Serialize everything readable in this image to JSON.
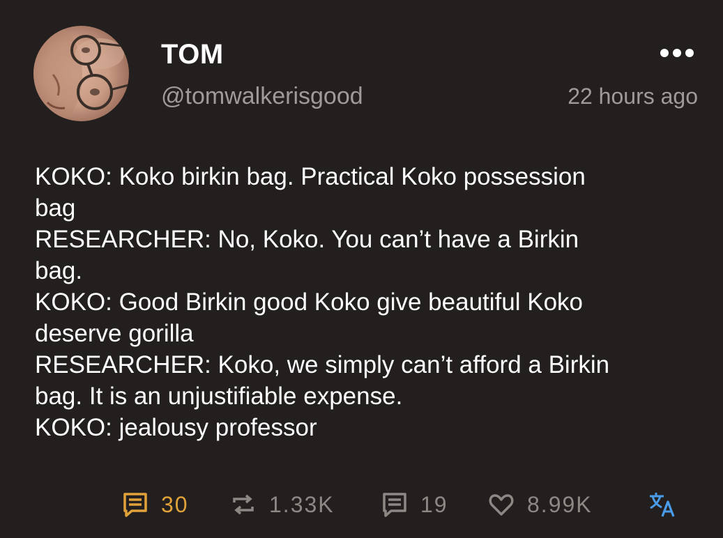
{
  "post": {
    "author": {
      "display_name": "TOM",
      "handle": "@tomwalkerisgood"
    },
    "timestamp": "22 hours ago",
    "content_lines": [
      "KOKO: Koko birkin bag. Practical Koko possession",
      "bag",
      "RESEARCHER: No, Koko. You can’t have a Birkin",
      "bag.",
      "KOKO: Good Birkin good Koko give beautiful Koko",
      "deserve gorilla",
      "RESEARCHER: Koko, we simply can’t afford a Birkin",
      "bag. It is an unjustifiable expense.",
      "KOKO: jealousy professor"
    ],
    "actions": {
      "replies": "30",
      "boosts": "1.33K",
      "quotes": "19",
      "likes": "8.99K"
    }
  },
  "icons": {
    "more": "more-horizontal-icon",
    "reply": "reply-icon",
    "boost": "repost-icon",
    "quote": "quote-icon",
    "like": "heart-icon",
    "translate": "translate-icon"
  },
  "colors": {
    "background": "#231f1e",
    "text": "#ffffff",
    "muted": "#a09a98",
    "reply_accent": "#e2a23a",
    "translate_accent": "#4a9be8"
  }
}
